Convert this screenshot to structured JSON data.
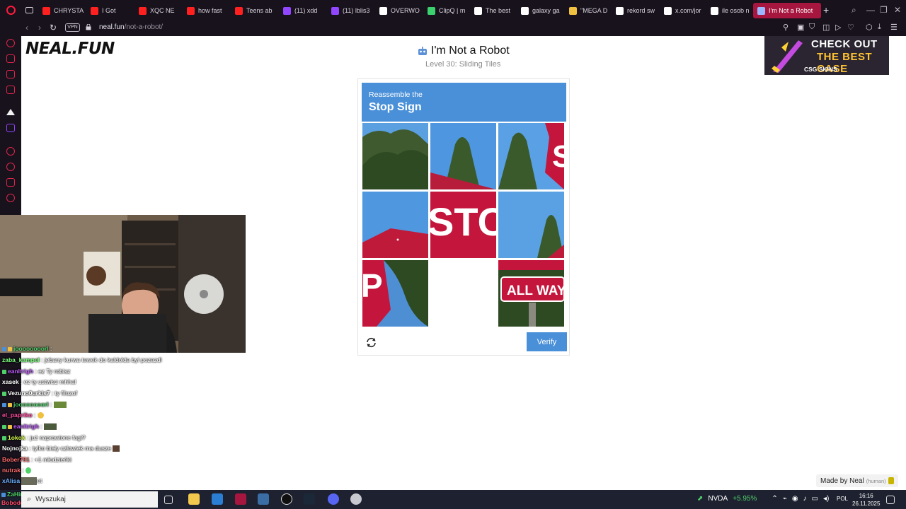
{
  "browser": {
    "tabs": [
      {
        "label": "CHRYSTA",
        "color": "#ff2020"
      },
      {
        "label": "I Got",
        "color": "#ff2020"
      },
      {
        "label": "XQC NE",
        "color": "#ff2020"
      },
      {
        "label": "how fast",
        "color": "#ff2020"
      },
      {
        "label": "Teens ab",
        "color": "#ff2020"
      },
      {
        "label": "(11) xdd",
        "color": "#9146ff"
      },
      {
        "label": "(11) lblis3",
        "color": "#9146ff"
      },
      {
        "label": "OVERWO",
        "color": "#ffffff"
      },
      {
        "label": "ClipQ | m",
        "color": "#3bd16f"
      },
      {
        "label": "The best",
        "color": "#ffffff"
      },
      {
        "label": "galaxy ga",
        "color": "#ffffff"
      },
      {
        "label": "\"MEGA D",
        "color": "#f0c040"
      },
      {
        "label": "rekord sw",
        "color": "#ffffff"
      },
      {
        "label": "x.com/jor",
        "color": "#ffffff"
      },
      {
        "label": "ile osob n",
        "color": "#ffffff"
      },
      {
        "label": "I'm Not a Robot",
        "color": "#9bb8ff"
      }
    ],
    "active_tab": "I'm Not a Robot",
    "new_tab": "+",
    "vpn_label": "VPN",
    "url_host": "neal.fun",
    "url_path": "/not-a-robot/"
  },
  "page": {
    "logo": "NEAL.FUN",
    "title": "I'm Not a Robot",
    "level": "Level 30: Sliding Tiles",
    "captcha": {
      "instruction": "Reassemble the",
      "target": "Stop Sign",
      "verify_label": "Verify",
      "empty_slot": {
        "row": 3,
        "col": 2
      }
    },
    "made_by": "Made by Neal",
    "made_by_tag": "(human)",
    "ad": {
      "line1": "CHECK OUT",
      "line2": "THE BEST CASE",
      "brand": "CSG SKINS"
    }
  },
  "chat": [
    {
      "user": "joooooooorl",
      "color": "#4fd16a",
      "msg": ":"
    },
    {
      "user": "zaba_kampel",
      "color": "#7bff7b",
      "msg": ": jebany kurwa tewek do kaldolda byl pozazdl"
    },
    {
      "user": "eanltrigh",
      "color": "#c05bff",
      "msg": ": ez Ty robisz"
    },
    {
      "user": "xasek",
      "color": "#ffffff",
      "msg": ": ez ty ustwisz mhhal"
    },
    {
      "user": "Vezuno0urkis7",
      "color": "#ffffff",
      "msg": ": ty filozof"
    },
    {
      "user": "joooooooorl",
      "color": "#4fd16a",
      "msg": ":"
    },
    {
      "user": "el_papriko",
      "color": "#ff4aa0",
      "msg": ":"
    },
    {
      "user": "eanltrigh",
      "color": "#c05bff",
      "msg": ":"
    },
    {
      "user": "1okok",
      "color": "#d8ff4a",
      "msg": ": już naprawione fagi?"
    },
    {
      "user": "Nojnojka",
      "color": "#ffffff",
      "msg": ": tylko biały człowiek ma dusze"
    },
    {
      "user": "Bober791",
      "color": "#ff6b6b",
      "msg": ": +1 młodzieńki"
    },
    {
      "user": "nutrak",
      "color": "#ff6b6b",
      "msg": ":"
    },
    {
      "user": "xAlisa",
      "color": "#6bb0ff",
      "msg": "et"
    },
    {
      "user": "ZaHir",
      "color": "#4fd16a",
      "msg": ":"
    },
    {
      "user": "Bobodek",
      "color": "#ff4a6b",
      "msg": ""
    }
  ],
  "taskbar": {
    "search": "Wyszukaj",
    "stock_name": "NVDA",
    "stock_change": "+5.95%",
    "lang": "POL",
    "time": "16:16",
    "date": "26.11.2025"
  },
  "colors": {
    "browser_bg": "#17121c",
    "accent": "#a7163f",
    "captcha_blue": "#4a90d9",
    "sidebar_icon": "#e0254a"
  }
}
